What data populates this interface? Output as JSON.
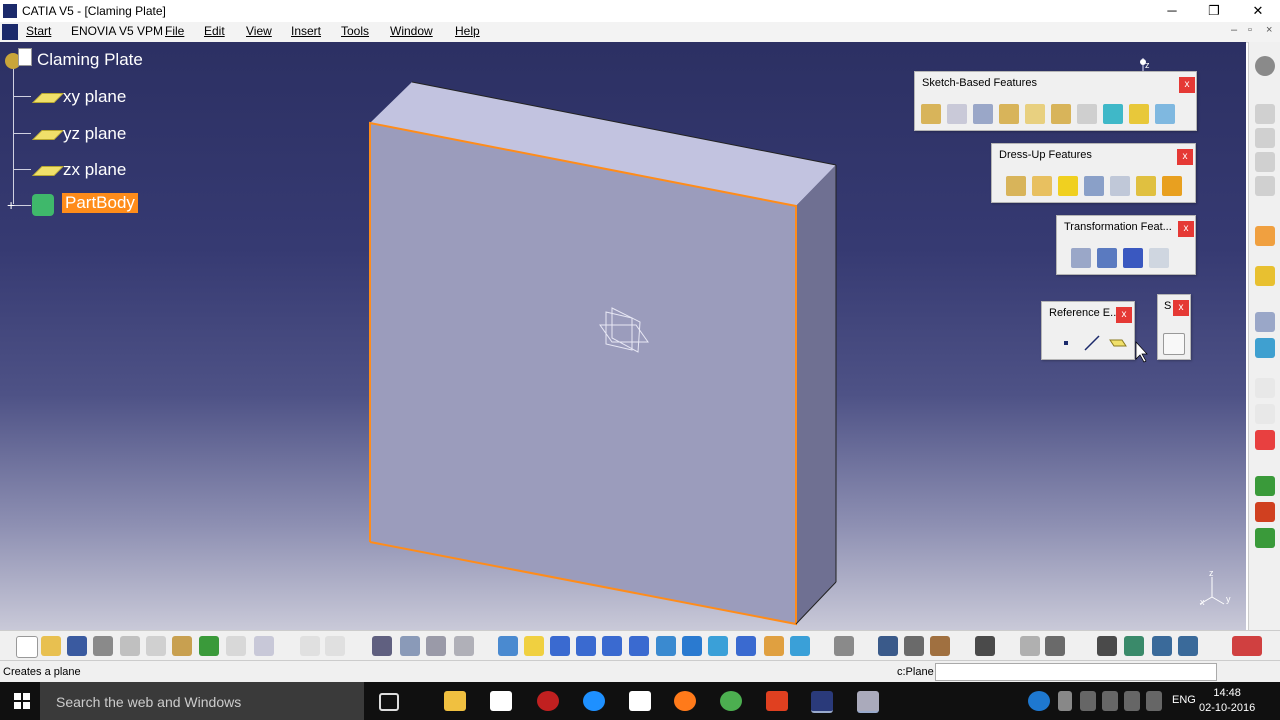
{
  "window": {
    "title": "CATIA V5 - [Claming Plate]",
    "minimize_glyph": "─",
    "restore_glyph": "❐",
    "close_glyph": "✕",
    "inner_minimize_glyph": "–",
    "inner_restore_glyph": "▫",
    "inner_close_glyph": "×"
  },
  "menu": [
    "Start",
    "ENOVIA V5 VPM",
    "File",
    "Edit",
    "View",
    "Insert",
    "Tools",
    "Window",
    "Help"
  ],
  "tree": {
    "root": "Claming Plate",
    "items": [
      "xy plane",
      "yz plane",
      "zx plane"
    ],
    "selected": "PartBody"
  },
  "toolbars": {
    "sketch_based": {
      "title": "Sketch-Based Features",
      "close": "x"
    },
    "dress_up": {
      "title": "Dress-Up Features",
      "close": "x"
    },
    "transformation": {
      "title": "Transformation Feat...",
      "close": "x"
    },
    "reference": {
      "title": "Reference E...",
      "close": "x"
    },
    "sketcher": {
      "title": "S",
      "close": "x"
    }
  },
  "compass": {
    "z_label": "z"
  },
  "axis_triad": {
    "z": "z",
    "x": "x",
    "y": "y"
  },
  "status": {
    "message": "Creates a plane",
    "command_label": "c:Plane"
  },
  "taskbar": {
    "search_placeholder": "Search the web and Windows",
    "language": "ENG",
    "time": "14:48",
    "date": "02-10-2016"
  },
  "colors": {
    "viewport_top": "#2c3063",
    "part_face": "#9b9cbc",
    "part_top": "#c2c3e0",
    "part_side": "#6f7092",
    "highlight_edge": "#ff8c1a",
    "selection_bg": "#ff8c1a"
  }
}
